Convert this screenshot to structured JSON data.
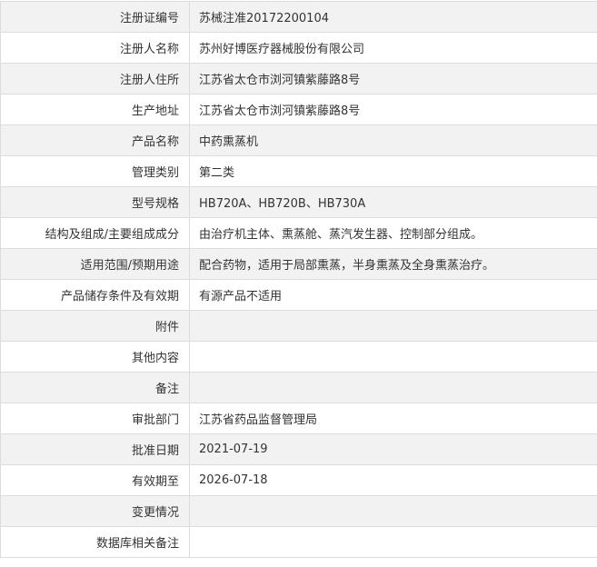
{
  "rows": [
    {
      "label": "注册证编号",
      "value": "苏械注准20172200104"
    },
    {
      "label": "注册人名称",
      "value": "苏州好博医疗器械股份有限公司"
    },
    {
      "label": "注册人住所",
      "value": "江苏省太仓市浏河镇紫藤路8号"
    },
    {
      "label": "生产地址",
      "value": "江苏省太仓市浏河镇紫藤路8号"
    },
    {
      "label": "产品名称",
      "value": "中药熏蒸机"
    },
    {
      "label": "管理类别",
      "value": "第二类"
    },
    {
      "label": "型号规格",
      "value": "HB720A、HB720B、HB730A"
    },
    {
      "label": "结构及组成/主要组成成分",
      "value": "由治疗机主体、熏蒸舱、蒸汽发生器、控制部分组成。"
    },
    {
      "label": "适用范围/预期用途",
      "value": "配合药物，适用于局部熏蒸，半身熏蒸及全身熏蒸治疗。"
    },
    {
      "label": "产品储存条件及有效期",
      "value": "有源产品不适用"
    },
    {
      "label": "附件",
      "value": ""
    },
    {
      "label": "其他内容",
      "value": ""
    },
    {
      "label": "备注",
      "value": ""
    },
    {
      "label": "审批部门",
      "value": "江苏省药品监督管理局"
    },
    {
      "label": "批准日期",
      "value": "2021-07-19"
    },
    {
      "label": "有效期至",
      "value": "2026-07-18"
    },
    {
      "label": "变更情况",
      "value": ""
    },
    {
      "label": "数据库相关备注",
      "value": ""
    }
  ]
}
